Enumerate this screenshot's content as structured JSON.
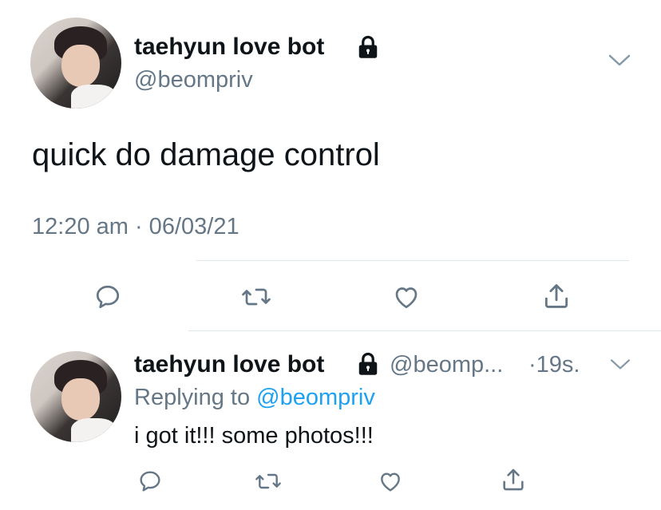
{
  "main_tweet": {
    "display_name": "taehyun love bot",
    "handle": "@beompriv",
    "text": "quick do damage control",
    "timestamp": "12:20 am · 06/03/21"
  },
  "reply_tweet": {
    "display_name": "taehyun love bot",
    "handle": "@beomp...",
    "age": "·19s.",
    "replying_prefix": "Replying to",
    "replying_handle": "@beompriv",
    "text": "i got it!!! some photos!!!"
  },
  "icons": [
    "lock-icon",
    "chevron-down-icon",
    "reply-icon",
    "retweet-icon",
    "like-icon",
    "share-icon"
  ],
  "colors": {
    "text": "#0f1419",
    "muted": "#657786",
    "link": "#1da1f2",
    "divider": "#e1e8ed"
  }
}
